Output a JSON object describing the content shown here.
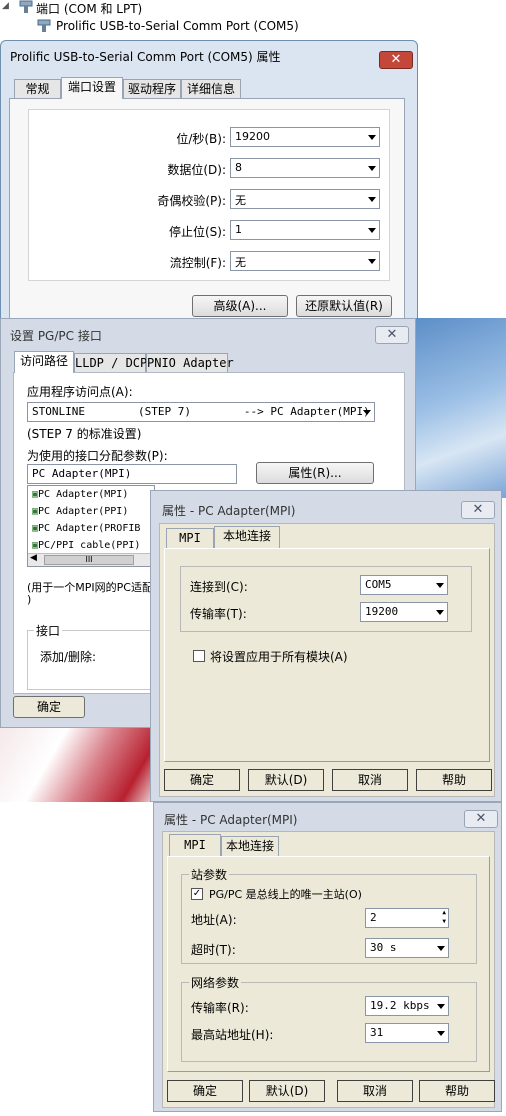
{
  "device_tree": {
    "category": "端口 (COM 和 LPT)",
    "device": "Prolific USB-to-Serial Comm Port (COM5)"
  },
  "win1": {
    "title": "Prolific USB-to-Serial Comm Port (COM5) 属性",
    "close": "✕",
    "tabs": [
      "常规",
      "端口设置",
      "驱动程序",
      "详细信息"
    ],
    "fields": [
      {
        "label": "位/秒(B):",
        "value": "19200"
      },
      {
        "label": "数据位(D):",
        "value": "8"
      },
      {
        "label": "奇偶校验(P):",
        "value": "无"
      },
      {
        "label": "停止位(S):",
        "value": "1"
      },
      {
        "label": "流控制(F):",
        "value": "无"
      }
    ],
    "advanced_button": "高级(A)...",
    "restore_button": "还原默认值(R)"
  },
  "win2": {
    "title": "设置 PG/PC 接口",
    "close": "✕",
    "tabs": [
      "访问路径",
      "LLDP / DCP",
      "PNIO Adapter"
    ],
    "access_point_label": "应用程序访问点(A):",
    "access_point_value": "STONLINE        (STEP 7)        --> PC Adapter(MPI)",
    "access_point_note": "(STEP 7 的标准设置)",
    "interface_label": "为使用的接口分配参数(P):",
    "interface_value": "PC Adapter(MPI)",
    "properties_button": "属性(R)...",
    "list_items": [
      "PC Adapter(MPI)",
      "PC Adapter(PPI)",
      "PC Adapter(PROFIB",
      "PC/PPI cable(PPI)"
    ],
    "scroll_mark": "III",
    "hint_text": "(用于一个MPI网的PC适配",
    "hint_text2": ")",
    "interface_group": "接口",
    "add_remove": "添加/删除:",
    "ok_button": "确定"
  },
  "win3": {
    "title": "属性 - PC Adapter(MPI)",
    "close": "✕",
    "tabs": [
      "MPI",
      "本地连接"
    ],
    "connect_label": "连接到(C):",
    "connect_value": "COM5",
    "rate_label": "传输率(T):",
    "rate_value": "19200",
    "apply_all_label": "将设置应用于所有模块(A)",
    "buttons": [
      "确定",
      "默认(D)",
      "取消",
      "帮助"
    ]
  },
  "win4": {
    "title": "属性 - PC Adapter(MPI)",
    "close": "✕",
    "tabs": [
      "MPI",
      "本地连接"
    ],
    "station_group": "站参数",
    "only_master_label": "PG/PC 是总线上的唯一主站(O)",
    "only_master_checked": true,
    "address_label": "地址(A):",
    "address_value": "2",
    "timeout_label": "超时(T):",
    "timeout_value": "30 s",
    "network_group": "网络参数",
    "rate_label": "传输率(R):",
    "rate_value": "19.2 kbps",
    "highest_label": "最高站地址(H):",
    "highest_value": "31",
    "buttons": [
      "确定",
      "默认(D)",
      "取消",
      "帮助"
    ]
  }
}
